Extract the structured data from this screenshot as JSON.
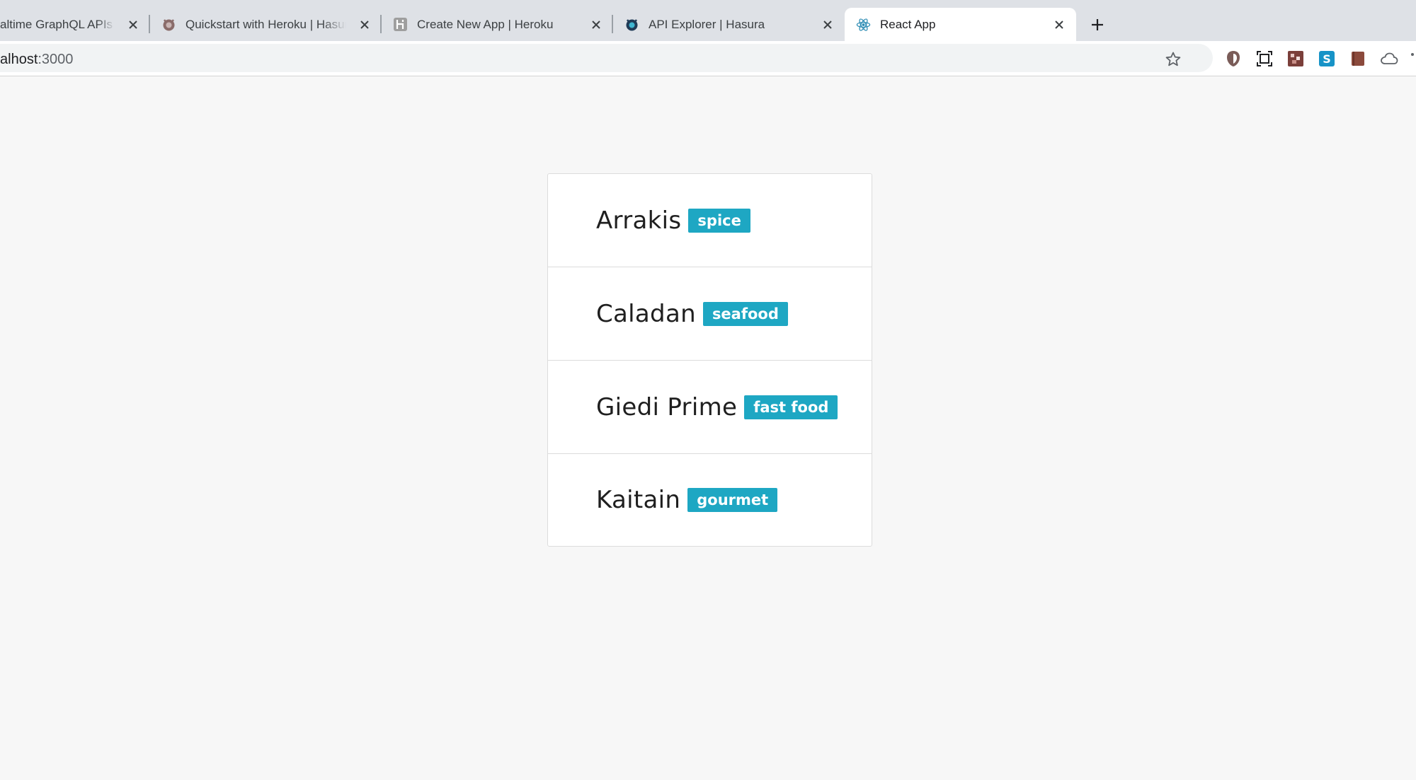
{
  "tabs": [
    {
      "title": "altime GraphQL APIs o",
      "icon": "partial-tab-icon"
    },
    {
      "title": "Quickstart with Heroku | Hasura",
      "icon": "hasura-icon"
    },
    {
      "title": "Create New App | Heroku",
      "icon": "heroku-icon"
    },
    {
      "title": "API Explorer | Hasura",
      "icon": "hasura-icon"
    },
    {
      "title": "React App",
      "icon": "react-icon",
      "active": true
    }
  ],
  "address_bar": {
    "host": "alhost",
    "port": ":3000"
  },
  "extensions": [
    "shield-extension-icon",
    "screenshot-extension-icon",
    "pixel-extension-icon",
    "s-extension-icon",
    "book-extension-icon",
    "cloud-extension-icon"
  ],
  "locations": [
    {
      "name": "Arrakis",
      "tag": "spice"
    },
    {
      "name": "Caladan",
      "tag": "seafood"
    },
    {
      "name": "Giedi Prime",
      "tag": "fast food"
    },
    {
      "name": "Kaitain",
      "tag": "gourmet"
    }
  ],
  "colors": {
    "tag_bg": "#1ea7c3",
    "page_bg": "#f7f7f7",
    "tabstrip_bg": "#dee1e6"
  }
}
